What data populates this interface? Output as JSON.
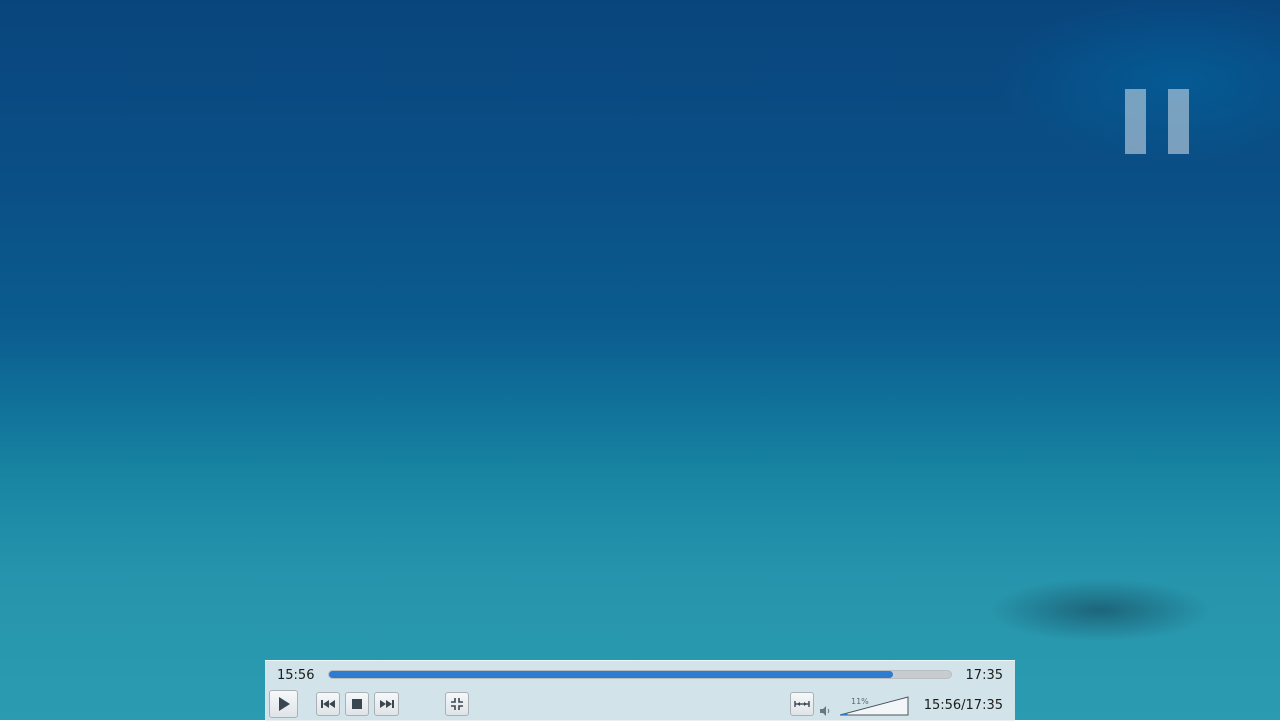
{
  "player": {
    "pause_overlay_icon": "pause-icon",
    "elapsed_time": "15:56",
    "total_time": "17:35",
    "combined_time": "15:56/17:35",
    "progress_fraction": 0.907,
    "volume_label": "11%",
    "volume_fraction": 0.11,
    "buttons": [
      {
        "name": "play",
        "icon": "play-icon"
      },
      {
        "name": "previous",
        "icon": "skip-previous-icon"
      },
      {
        "name": "stop",
        "icon": "stop-icon"
      },
      {
        "name": "next",
        "icon": "skip-next-icon"
      },
      {
        "name": "fullscreen",
        "icon": "fullscreen-exit-icon"
      },
      {
        "name": "extended-settings",
        "icon": "extended-settings-icon"
      },
      {
        "name": "mute",
        "icon": "speaker-icon"
      }
    ],
    "colors": {
      "progress_fill": "#2f7bd0",
      "controller_bg": "#e9eef1"
    }
  }
}
